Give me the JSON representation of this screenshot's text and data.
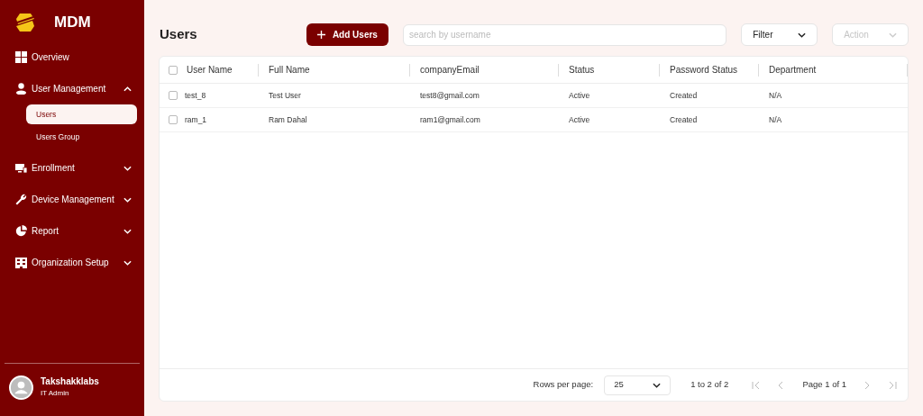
{
  "brand": {
    "name": "MDM"
  },
  "nav": [
    {
      "label": "Overview",
      "kind": "link"
    },
    {
      "label": "User Management",
      "kind": "group",
      "expanded": true,
      "children": [
        {
          "label": "Users",
          "selected": true
        },
        {
          "label": "Users Group",
          "selected": false
        }
      ]
    },
    {
      "label": "Enrollment",
      "kind": "group",
      "expanded": false
    },
    {
      "label": "Device Management",
      "kind": "group",
      "expanded": false
    },
    {
      "label": "Report",
      "kind": "group",
      "expanded": false
    },
    {
      "label": "Organization Setup",
      "kind": "group",
      "expanded": false
    }
  ],
  "user": {
    "name": "Takshakklabs",
    "role": "IT Admin"
  },
  "page_title": "Users",
  "add_button": "Add Users",
  "search": {
    "placeholder": "search by username"
  },
  "filter": {
    "label": "Filter",
    "disabled": false
  },
  "action": {
    "label": "Action",
    "disabled": true
  },
  "table": {
    "select_all_checked": false,
    "columns": [
      "User Name",
      "Full Name",
      "companyEmail",
      "Status",
      "Password Status",
      "Department"
    ],
    "rows": [
      {
        "checked": false,
        "cells": [
          "test_8",
          "Test User",
          "test8@gmail.com",
          "Active",
          "Created",
          "N/A"
        ]
      },
      {
        "checked": false,
        "cells": [
          "ram_1",
          "Ram Dahal",
          "ram1@gmail.com",
          "Active",
          "Created",
          "N/A"
        ]
      }
    ]
  },
  "pagination": {
    "rows_label": "Rows per page:",
    "rows_value": "25",
    "range": "1 to 2 of 2",
    "page": "Page 1 of 1",
    "first_disabled": true,
    "prev_disabled": true,
    "next_disabled": true,
    "last_disabled": true
  }
}
